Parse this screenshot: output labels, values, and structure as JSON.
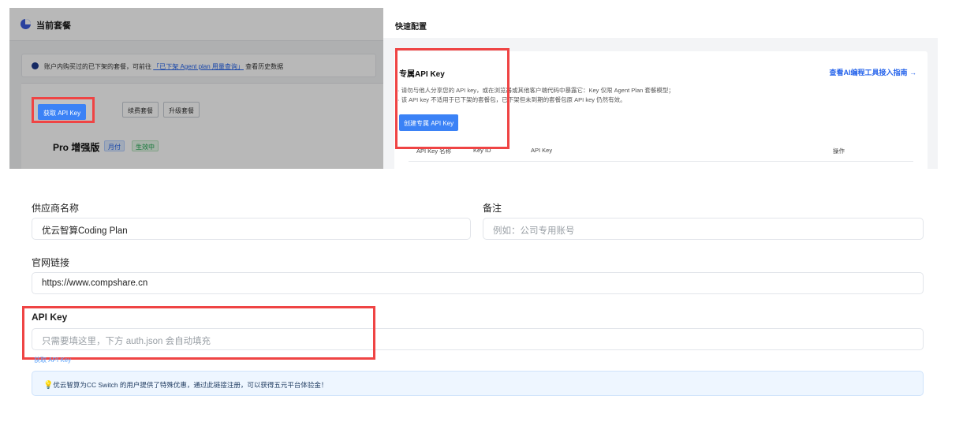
{
  "top_left": {
    "header_title": "当前套餐",
    "notice_prefix": "账户内购买过的已下架的套餐，可前往",
    "notice_link": "「已下架 Agent plan 用量查询」",
    "notice_suffix": "查看历史数据",
    "buttons": {
      "get_api_key": "获取 API Key",
      "renew": "续费套餐",
      "upgrade": "升级套餐"
    },
    "plan_name": "Pro 增强版",
    "tags": {
      "billing": "月付",
      "status": "生效中"
    }
  },
  "top_right": {
    "header_title": "快速配置",
    "panel_title": "专属API Key",
    "guide_link": "查看AI编程工具接入指南 →",
    "lines": [
      "· 请勿与他人分享您的 API key，或在浏览器或其他客户端代码中暴露它：Key 仅限 Agent Plan 套餐模型；",
      "· 该 API key 不适用于已下架的套餐包，已下架但未到期的套餐包原 API key 仍然有效。"
    ],
    "create_button": "创建专属 API Key",
    "table_headers": {
      "name": "API Key 名称",
      "key_id": "Key ID",
      "api_key": "API Key",
      "actions": "操作"
    }
  },
  "form": {
    "provider_label": "供应商名称",
    "provider_value": "优云智算Coding Plan",
    "remark_label": "备注",
    "remark_placeholder": "例如：公司专用账号",
    "website_label": "官网链接",
    "website_value": "https://www.compshare.cn",
    "api_key_label": "API Key",
    "api_key_placeholder": "只需要填这里，下方 auth.json 会自动填充",
    "get_api_key_link": "获取 API Key",
    "tip_text": "优云智算为CC Switch 的用户提供了特殊优惠，通过此链接注册，可以获得五元平台体验金！"
  },
  "colors": {
    "accent": "#3b82f6",
    "highlight": "#ef4444",
    "tip_bg": "#eef6ff"
  },
  "icons": {
    "plan": "pie-icon",
    "notice": "info-icon",
    "tip": "lightbulb-icon"
  }
}
